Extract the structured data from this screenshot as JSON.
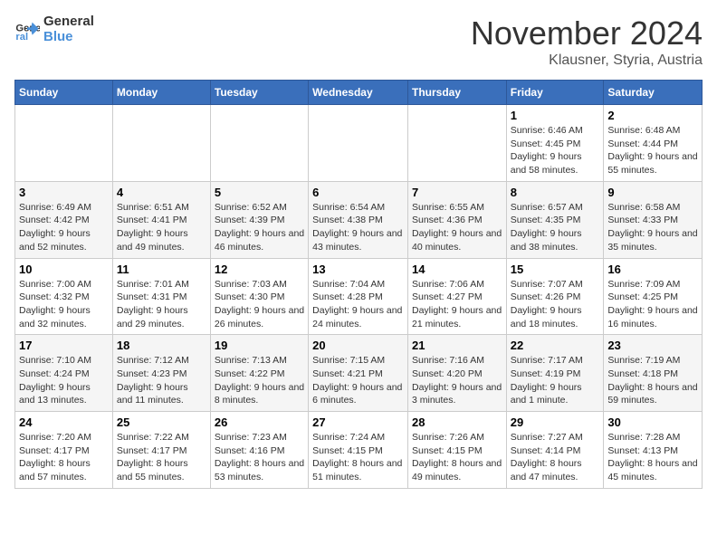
{
  "logo": {
    "line1": "General",
    "line2": "Blue"
  },
  "title": "November 2024",
  "location": "Klausner, Styria, Austria",
  "days_of_week": [
    "Sunday",
    "Monday",
    "Tuesday",
    "Wednesday",
    "Thursday",
    "Friday",
    "Saturday"
  ],
  "weeks": [
    [
      {
        "day": "",
        "info": ""
      },
      {
        "day": "",
        "info": ""
      },
      {
        "day": "",
        "info": ""
      },
      {
        "day": "",
        "info": ""
      },
      {
        "day": "",
        "info": ""
      },
      {
        "day": "1",
        "info": "Sunrise: 6:46 AM\nSunset: 4:45 PM\nDaylight: 9 hours and 58 minutes."
      },
      {
        "day": "2",
        "info": "Sunrise: 6:48 AM\nSunset: 4:44 PM\nDaylight: 9 hours and 55 minutes."
      }
    ],
    [
      {
        "day": "3",
        "info": "Sunrise: 6:49 AM\nSunset: 4:42 PM\nDaylight: 9 hours and 52 minutes."
      },
      {
        "day": "4",
        "info": "Sunrise: 6:51 AM\nSunset: 4:41 PM\nDaylight: 9 hours and 49 minutes."
      },
      {
        "day": "5",
        "info": "Sunrise: 6:52 AM\nSunset: 4:39 PM\nDaylight: 9 hours and 46 minutes."
      },
      {
        "day": "6",
        "info": "Sunrise: 6:54 AM\nSunset: 4:38 PM\nDaylight: 9 hours and 43 minutes."
      },
      {
        "day": "7",
        "info": "Sunrise: 6:55 AM\nSunset: 4:36 PM\nDaylight: 9 hours and 40 minutes."
      },
      {
        "day": "8",
        "info": "Sunrise: 6:57 AM\nSunset: 4:35 PM\nDaylight: 9 hours and 38 minutes."
      },
      {
        "day": "9",
        "info": "Sunrise: 6:58 AM\nSunset: 4:33 PM\nDaylight: 9 hours and 35 minutes."
      }
    ],
    [
      {
        "day": "10",
        "info": "Sunrise: 7:00 AM\nSunset: 4:32 PM\nDaylight: 9 hours and 32 minutes."
      },
      {
        "day": "11",
        "info": "Sunrise: 7:01 AM\nSunset: 4:31 PM\nDaylight: 9 hours and 29 minutes."
      },
      {
        "day": "12",
        "info": "Sunrise: 7:03 AM\nSunset: 4:30 PM\nDaylight: 9 hours and 26 minutes."
      },
      {
        "day": "13",
        "info": "Sunrise: 7:04 AM\nSunset: 4:28 PM\nDaylight: 9 hours and 24 minutes."
      },
      {
        "day": "14",
        "info": "Sunrise: 7:06 AM\nSunset: 4:27 PM\nDaylight: 9 hours and 21 minutes."
      },
      {
        "day": "15",
        "info": "Sunrise: 7:07 AM\nSunset: 4:26 PM\nDaylight: 9 hours and 18 minutes."
      },
      {
        "day": "16",
        "info": "Sunrise: 7:09 AM\nSunset: 4:25 PM\nDaylight: 9 hours and 16 minutes."
      }
    ],
    [
      {
        "day": "17",
        "info": "Sunrise: 7:10 AM\nSunset: 4:24 PM\nDaylight: 9 hours and 13 minutes."
      },
      {
        "day": "18",
        "info": "Sunrise: 7:12 AM\nSunset: 4:23 PM\nDaylight: 9 hours and 11 minutes."
      },
      {
        "day": "19",
        "info": "Sunrise: 7:13 AM\nSunset: 4:22 PM\nDaylight: 9 hours and 8 minutes."
      },
      {
        "day": "20",
        "info": "Sunrise: 7:15 AM\nSunset: 4:21 PM\nDaylight: 9 hours and 6 minutes."
      },
      {
        "day": "21",
        "info": "Sunrise: 7:16 AM\nSunset: 4:20 PM\nDaylight: 9 hours and 3 minutes."
      },
      {
        "day": "22",
        "info": "Sunrise: 7:17 AM\nSunset: 4:19 PM\nDaylight: 9 hours and 1 minute."
      },
      {
        "day": "23",
        "info": "Sunrise: 7:19 AM\nSunset: 4:18 PM\nDaylight: 8 hours and 59 minutes."
      }
    ],
    [
      {
        "day": "24",
        "info": "Sunrise: 7:20 AM\nSunset: 4:17 PM\nDaylight: 8 hours and 57 minutes."
      },
      {
        "day": "25",
        "info": "Sunrise: 7:22 AM\nSunset: 4:17 PM\nDaylight: 8 hours and 55 minutes."
      },
      {
        "day": "26",
        "info": "Sunrise: 7:23 AM\nSunset: 4:16 PM\nDaylight: 8 hours and 53 minutes."
      },
      {
        "day": "27",
        "info": "Sunrise: 7:24 AM\nSunset: 4:15 PM\nDaylight: 8 hours and 51 minutes."
      },
      {
        "day": "28",
        "info": "Sunrise: 7:26 AM\nSunset: 4:15 PM\nDaylight: 8 hours and 49 minutes."
      },
      {
        "day": "29",
        "info": "Sunrise: 7:27 AM\nSunset: 4:14 PM\nDaylight: 8 hours and 47 minutes."
      },
      {
        "day": "30",
        "info": "Sunrise: 7:28 AM\nSunset: 4:13 PM\nDaylight: 8 hours and 45 minutes."
      }
    ]
  ]
}
